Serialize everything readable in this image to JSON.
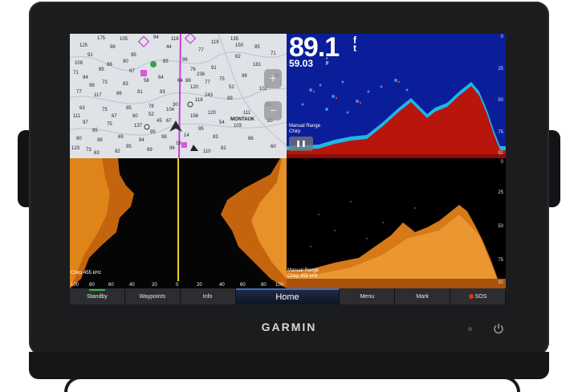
{
  "brand": "GARMIN",
  "sonar_top": {
    "depth_value": "89.1",
    "depth_unit_top": "f",
    "depth_unit_bottom": "t",
    "temp_value": "59.03",
    "temp_unit_top": "°",
    "temp_unit_bottom": "F",
    "range_label": "Manual Range",
    "mode_label": "Chirp",
    "scale": [
      "0",
      "25",
      "50",
      "75",
      "92"
    ],
    "pause_icon": "pause-icon"
  },
  "chart": {
    "place_label": "MONTAUK",
    "zoom_in": "+",
    "zoom_out": "−",
    "soundings": [
      "175",
      "105",
      "125",
      "98",
      "91",
      "95",
      "109",
      "86",
      "44",
      "135",
      "85",
      "82",
      "94",
      "73",
      "83",
      "64",
      "77",
      "117",
      "86",
      "81",
      "76",
      "91",
      "75",
      "98",
      "63",
      "75",
      "85",
      "78",
      "97",
      "75",
      "120",
      "118",
      "120",
      "89",
      "80",
      "98",
      "69",
      "94",
      "73",
      "82",
      "95",
      "83",
      "103",
      "86",
      "80",
      "60",
      "93",
      "45",
      "99",
      "95",
      "96",
      "110",
      "96",
      "102",
      "181",
      "67",
      "85",
      "77",
      "119",
      "76",
      "137",
      "156",
      "104",
      "82",
      "111",
      "85",
      "58",
      "52",
      "14",
      "77",
      "71",
      "111",
      "85",
      "95",
      "69",
      "94",
      "118",
      "71",
      "81",
      "123",
      "67",
      "80",
      "90",
      "63",
      "150",
      "88",
      "243",
      "236",
      "64",
      "16",
      "98",
      "54",
      "52",
      "30",
      "67"
    ]
  },
  "side_vu": {
    "mode_label": "Chirp 455 kHz",
    "scale": [
      "100",
      "80",
      "60",
      "40",
      "20",
      "0",
      "20",
      "40",
      "60",
      "80",
      "100"
    ]
  },
  "down_vu": {
    "range_label": "Manual Range",
    "mode_label": "Chirp 455 kHz",
    "scale": [
      "0",
      "25",
      "50",
      "75",
      "92"
    ]
  },
  "nav": {
    "standby": "Standby",
    "waypoints": "Waypoints",
    "info": "Info",
    "home": "Home",
    "menu": "Menu",
    "mark": "Mark",
    "sos": "SOS"
  },
  "colors": {
    "sonar_bg": "#0b1e9a",
    "sonar_return": "#b8150d",
    "side_vu": "#d67a18",
    "track_line": "#e8d01a",
    "route_line": "#c83ed6",
    "standby_indicator": "#23c43a",
    "sos": "#e0301e"
  }
}
